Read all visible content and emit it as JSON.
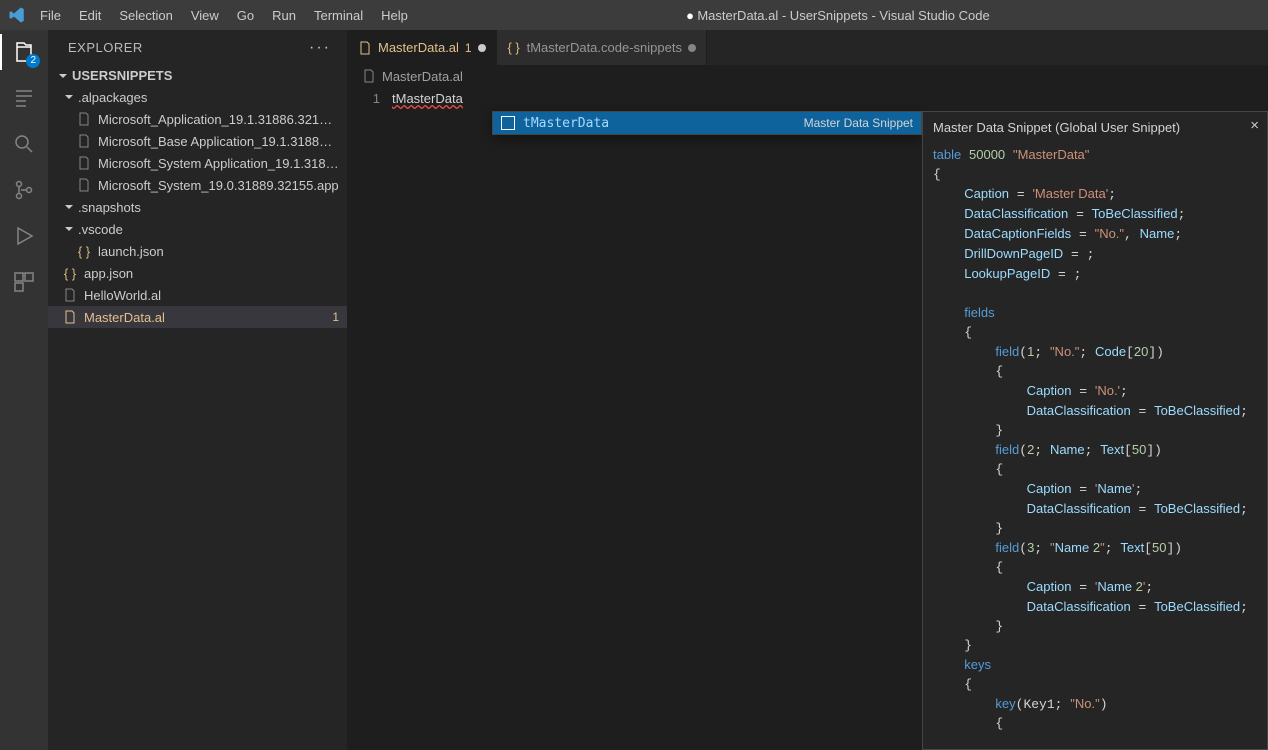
{
  "title": "MasterData.al - UserSnippets - Visual Studio Code",
  "menus": [
    "File",
    "Edit",
    "Selection",
    "View",
    "Go",
    "Run",
    "Terminal",
    "Help"
  ],
  "explorer_title": "EXPLORER",
  "section": "USERSNIPPETS",
  "activity_badge": "2",
  "tree": {
    "alpackages": ".alpackages",
    "files_alpackages": [
      "Microsoft_Application_19.1.31886.32186.app",
      "Microsoft_Base Application_19.1.31886.321...",
      "Microsoft_System Application_19.1.31886.3...",
      "Microsoft_System_19.0.31889.32155.app"
    ],
    "snapshots": ".snapshots",
    "vscode": ".vscode",
    "launch": "launch.json",
    "appjson": "app.json",
    "hello": "HelloWorld.al",
    "master": "MasterData.al",
    "master_badge": "1"
  },
  "tabs": {
    "t1": "MasterData.al",
    "t1_badge": "1",
    "t2": "tMasterData.code-snippets"
  },
  "breadcrumb": "MasterData.al",
  "line1_num": "1",
  "line1_code": "tMasterData",
  "suggest": {
    "name": "tMasterData",
    "type": "Master Data Snippet"
  },
  "doc": {
    "title": "Master Data Snippet (Global User Snippet)",
    "content": "table 50000 \"MasterData\"\n{\n    Caption = 'Master Data';\n    DataClassification = ToBeClassified;\n    DataCaptionFields = \"No.\", Name;\n    DrillDownPageID = ;\n    LookupPageID = ;\n\n    fields\n    {\n        field(1; \"No.\"; Code[20])\n        {\n            Caption = 'No.';\n            DataClassification = ToBeClassified;\n        }\n        field(2; Name; Text[50])\n        {\n            Caption = 'Name';\n            DataClassification = ToBeClassified;\n        }\n        field(3; \"Name 2\"; Text[50])\n        {\n            Caption = 'Name 2';\n            DataClassification = ToBeClassified;\n        }\n    }\n    keys\n    {\n        key(Key1; \"No.\")\n        {"
  }
}
